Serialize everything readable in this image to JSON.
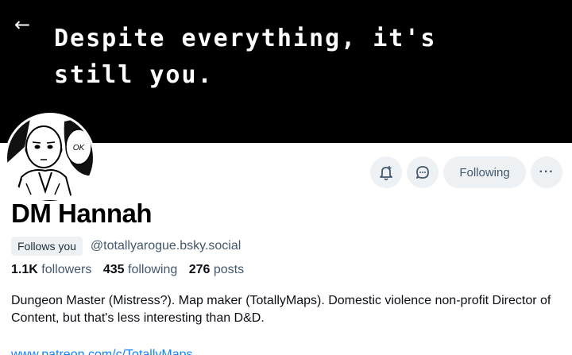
{
  "banner": {
    "text_line1": "Despite everything, it's",
    "text_line2": "still you."
  },
  "avatar": {
    "speech_bubble_text": "OK"
  },
  "actions": {
    "follow_button_label": "Following",
    "more_label": "···"
  },
  "profile": {
    "display_name": "DM Hannah",
    "follows_you_label": "Follows you",
    "handle": "@totallyarogue.bsky.social"
  },
  "stats": {
    "followers_count": "1.1K",
    "followers_label": "followers",
    "following_count": "435",
    "following_label": "following",
    "posts_count": "276",
    "posts_label": "posts"
  },
  "bio": {
    "text": "Dungeon Master (Mistress?). Map maker (TotallyMaps). Domestic violence non-profit Director of Content, but that's less interesting than D&D."
  },
  "link": {
    "text": "www.patreon.com/c/TotallyMaps"
  },
  "colors": {
    "banner_bg": "#000000",
    "button_bg": "#eef1f4",
    "secondary_text": "#42576c",
    "link": "#1083fe"
  }
}
